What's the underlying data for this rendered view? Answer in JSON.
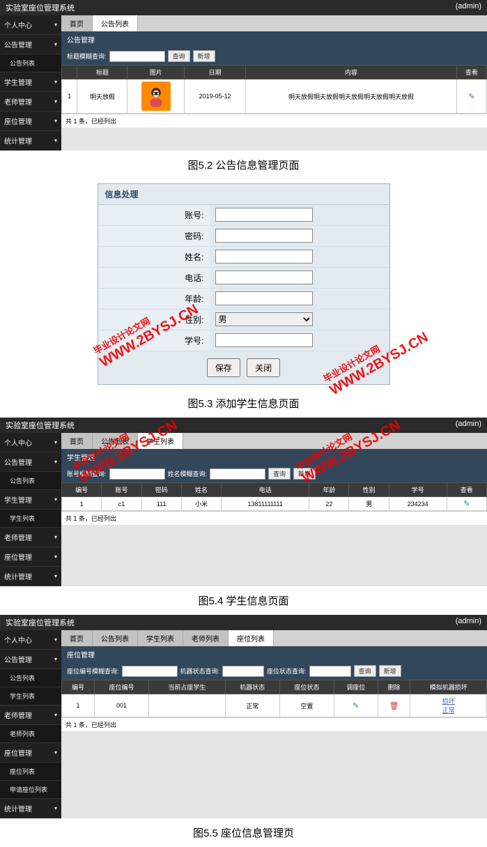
{
  "watermark_cn": "毕业设计论文网",
  "watermark_url": "WWW.2BYSJ.CN",
  "header": {
    "title": "实验室座位管理系统",
    "user": "(admin)"
  },
  "caption52": "图5.2 公告信息管理页面",
  "caption53": "图5.3 添加学生信息页面",
  "caption54": "图5.4 学生信息页面",
  "caption55": "图5.5 座位信息管理页",
  "sidebar": {
    "personal": "个人中心",
    "announce": "公告管理",
    "announce_list": "公告列表",
    "student": "学生管理",
    "student_list": "学生列表",
    "teacher": "老师管理",
    "teacher_list": "老师列表",
    "seat": "座位管理",
    "seat_list": "座位列表",
    "apply_seat_list": "申请座位列表",
    "stats": "统计管理",
    "chev": "▾"
  },
  "tabs": {
    "home": "首页",
    "announce_list": "公告列表",
    "student_list": "学生列表",
    "teacher_list": "老师列表",
    "seat_list": "座位列表"
  },
  "shot52": {
    "panel_title": "公告管理",
    "search_label": "标题模糊查询:",
    "search_btn": "查询",
    "add_btn": "新增",
    "cols": {
      "idx": "",
      "title": "标题",
      "pic": "图片",
      "date": "日期",
      "content": "内容",
      "view": "查看"
    },
    "row": {
      "idx": "1",
      "title": "明天放假",
      "date": "2019-05-12",
      "content": "明天放假明天放假明天放假明天放假明天放假"
    },
    "foot": "共 1 条，已经列出"
  },
  "dialog": {
    "title": "信息处理",
    "account": "账号:",
    "password": "密码:",
    "name": "姓名:",
    "phone": "电话:",
    "age": "年龄:",
    "gender": "性别:",
    "gender_val": "男",
    "sid": "学号:",
    "save": "保存",
    "close": "关闭"
  },
  "shot54": {
    "panel_title": "学生管理",
    "search_acct": "账号模糊查询:",
    "search_name": "姓名模糊查询:",
    "search_btn": "查询",
    "add_btn": "新增",
    "cols": {
      "idx": "编号",
      "acct": "账号",
      "pwd": "密码",
      "name": "姓名",
      "phone": "电话",
      "age": "年龄",
      "gender": "性别",
      "sid": "学号",
      "view": "查看"
    },
    "row": {
      "idx": "1",
      "acct": "c1",
      "pwd": "111",
      "name": "小米",
      "phone": "13811111111",
      "age": "22",
      "gender": "男",
      "sid": "234234"
    },
    "foot": "共 1 条，已经列出"
  },
  "shot55": {
    "panel_title": "座位管理",
    "search_no": "座位编号模糊查询:",
    "search_mach": "机器状态查询:",
    "search_seat": "座位状态查询:",
    "search_btn": "查询",
    "add_btn": "新增",
    "cols": {
      "idx": "编号",
      "seatno": "座位编号",
      "student": "当前占座学生",
      "mach": "机器状态",
      "seatst": "座位状态",
      "dispatch": "调座位",
      "del": "删除",
      "sim": "模拟机器损坏"
    },
    "row": {
      "idx": "1",
      "seatno": "001",
      "student": "",
      "mach": "正常",
      "seatst": "空置",
      "sim1": "损坏",
      "sim2": "正常"
    },
    "foot": "共 1 条，已经列出"
  }
}
